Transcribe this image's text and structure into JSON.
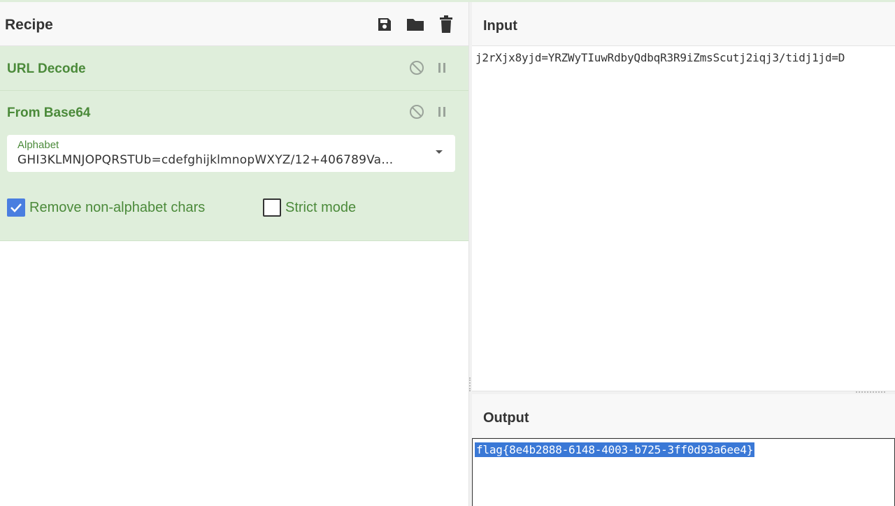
{
  "recipe": {
    "title": "Recipe",
    "actions": [
      {
        "icon": "save-icon",
        "label": "Save recipe"
      },
      {
        "icon": "folder-icon",
        "label": "Load recipe"
      },
      {
        "icon": "trash-icon",
        "label": "Clear recipe"
      }
    ],
    "operations": [
      {
        "name": "URL Decode",
        "disabled": false,
        "breakpoint": false
      },
      {
        "name": "From Base64",
        "disabled": false,
        "breakpoint": false,
        "alphabet_label": "Alphabet",
        "alphabet_value": "GHI3KLMNJOPQRSTUb=cdefghijklmnopWXYZ/12+406789Va…",
        "remove_non_alphabet_label": "Remove non-alphabet chars",
        "remove_non_alphabet_checked": true,
        "strict_mode_label": "Strict mode",
        "strict_mode_checked": false
      }
    ]
  },
  "input": {
    "title": "Input",
    "text": "j2rXjx8yjd=YRZWyTIuwRdbyQdbqR3R9iZmsScutj2iqj3/tidj1jd=D"
  },
  "output": {
    "title": "Output",
    "text": "flag{8e4b2888-6148-4003-b725-3ff0d93a6ee4}",
    "selection_color": "#3a78d6"
  },
  "colors": {
    "operation_bg": "#dfeedb",
    "operation_text": "#4b8a3a",
    "checkbox_checked": "#4a7ee0"
  }
}
